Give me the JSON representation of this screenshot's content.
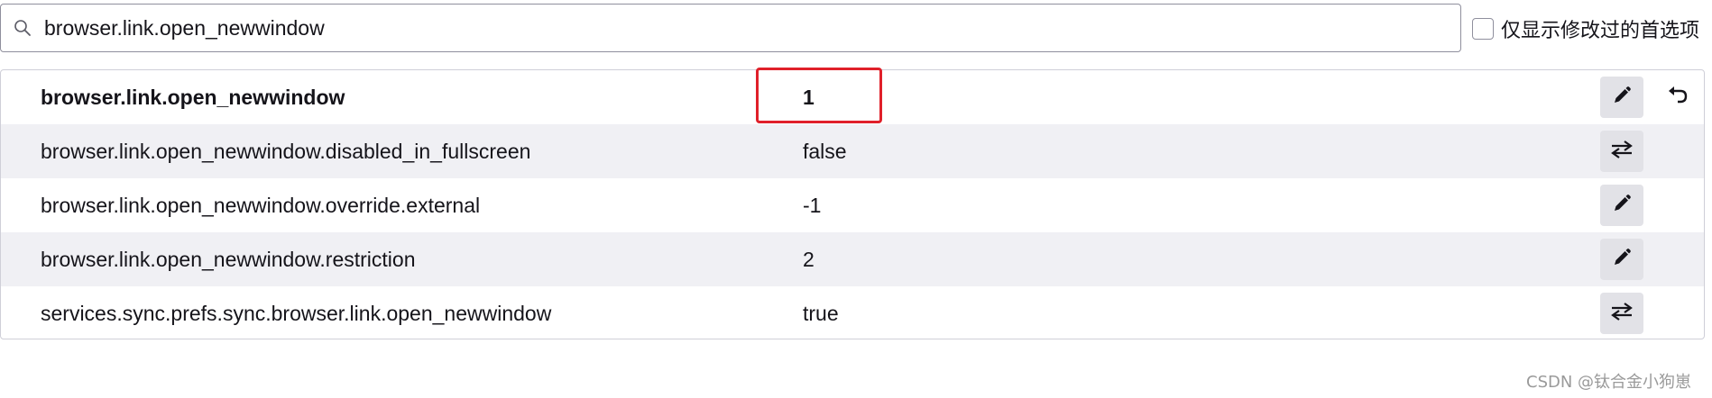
{
  "search": {
    "value": "browser.link.open_newwindow",
    "icon": "search-icon"
  },
  "filter": {
    "label": "仅显示修改过的首选项",
    "checked": false
  },
  "prefs": [
    {
      "name": "browser.link.open_newwindow",
      "value": "1",
      "modified": true,
      "action": "edit",
      "action_icon": "pencil-icon",
      "reset_icon": "undo-icon"
    },
    {
      "name": "browser.link.open_newwindow.disabled_in_fullscreen",
      "value": "false",
      "modified": false,
      "action": "toggle",
      "action_icon": "toggle-arrows-icon"
    },
    {
      "name": "browser.link.open_newwindow.override.external",
      "value": "-1",
      "modified": false,
      "action": "edit",
      "action_icon": "pencil-icon"
    },
    {
      "name": "browser.link.open_newwindow.restriction",
      "value": "2",
      "modified": false,
      "action": "edit",
      "action_icon": "pencil-icon"
    },
    {
      "name": "services.sync.prefs.sync.browser.link.open_newwindow",
      "value": "true",
      "modified": false,
      "action": "toggle",
      "action_icon": "toggle-arrows-icon"
    }
  ],
  "annotation": {
    "color": "#e0202a"
  },
  "watermark": "CSDN @钛合金小狗崽"
}
